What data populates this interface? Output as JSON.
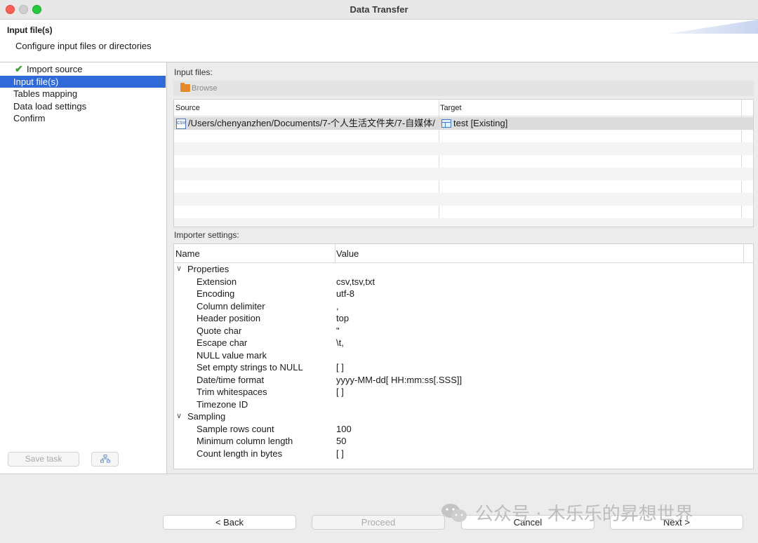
{
  "window": {
    "title": "Data Transfer"
  },
  "header": {
    "title": "Input file(s)",
    "description": "Configure input files or directories"
  },
  "sidebar": {
    "items": [
      {
        "label": "Import source",
        "checked": true
      },
      {
        "label": "Input file(s)",
        "selected": true
      },
      {
        "label": "Tables mapping"
      },
      {
        "label": "Data load settings"
      },
      {
        "label": "Confirm"
      }
    ],
    "save_task_label": "Save task"
  },
  "input_files": {
    "label": "Input files:",
    "browse_label": "Browse",
    "columns": [
      "Source",
      "Target"
    ],
    "rows": [
      {
        "icon": "csv-file-icon",
        "source": "/Users/chenyanzhen/Documents/7-个人生活文件夹/7-自媒体/",
        "target": "test [Existing]",
        "target_icon": "table-icon"
      }
    ]
  },
  "importer_settings": {
    "label": "Importer settings:",
    "columns": [
      "Name",
      "Value"
    ],
    "groups": [
      {
        "name": "Properties",
        "expanded": true,
        "props": [
          {
            "name": "Extension",
            "value": "csv,tsv,txt"
          },
          {
            "name": "Encoding",
            "value": "utf-8"
          },
          {
            "name": "Column delimiter",
            "value": ","
          },
          {
            "name": "Header position",
            "value": "top"
          },
          {
            "name": "Quote char",
            "value": "\""
          },
          {
            "name": "Escape char",
            "value": "\\t,"
          },
          {
            "name": "NULL value mark",
            "value": ""
          },
          {
            "name": "Set empty strings to NULL",
            "value": "[ ]"
          },
          {
            "name": "Date/time format",
            "value": "yyyy-MM-dd[ HH:mm:ss[.SSS]]"
          },
          {
            "name": "Trim whitespaces",
            "value": "[ ]"
          },
          {
            "name": "Timezone ID",
            "value": ""
          }
        ]
      },
      {
        "name": "Sampling",
        "expanded": true,
        "props": [
          {
            "name": "Sample rows count",
            "value": "100"
          },
          {
            "name": "Minimum column length",
            "value": "50"
          },
          {
            "name": "Count length in bytes",
            "value": "[ ]"
          }
        ]
      }
    ]
  },
  "footer": {
    "back_label": "< Back",
    "proceed_label": "Proceed",
    "cancel_label": "Cancel",
    "next_label": "Next >"
  },
  "watermark": {
    "text": "公众号 · 木乐乐的昇想世界"
  },
  "colors": {
    "selection": "#2f6ad8",
    "check": "#3aa13a",
    "folder": "#e58a2c"
  }
}
